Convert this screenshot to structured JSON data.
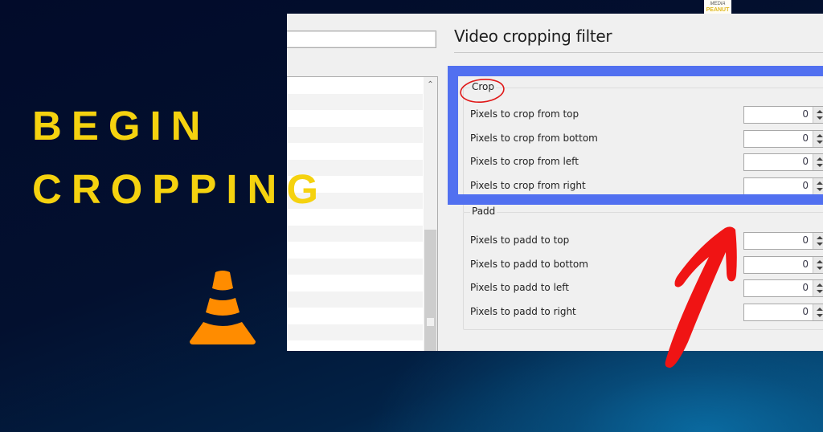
{
  "headline": {
    "line1": "BEGIN",
    "line2": "CROPPING"
  },
  "brand": {
    "line1": "MEDIA",
    "line2": "PEANUT"
  },
  "logo": {
    "icon": "vlc-cone-icon",
    "color": "#ff8c00"
  },
  "colors": {
    "accent_yellow": "#f5d20f",
    "highlight_blue": "#5170f0",
    "annotation_red": "#e81010"
  },
  "panel": {
    "search_value": "",
    "section_title": "Video cropping filter",
    "crop": {
      "label": "Crop",
      "fields": [
        {
          "label": "Pixels to crop from top",
          "value": "0"
        },
        {
          "label": "Pixels to crop from bottom",
          "value": "0"
        },
        {
          "label": "Pixels to crop from left",
          "value": "0"
        },
        {
          "label": "Pixels to crop from right",
          "value": "0"
        }
      ]
    },
    "padd": {
      "label": "Padd",
      "fields": [
        {
          "label": "Pixels to padd to top",
          "value": "0"
        },
        {
          "label": "Pixels to padd to bottom",
          "value": "0"
        },
        {
          "label": "Pixels to padd to left",
          "value": "0"
        },
        {
          "label": "Pixels to padd to right",
          "value": "0"
        }
      ]
    },
    "scroll_up_glyph": "⌃"
  }
}
